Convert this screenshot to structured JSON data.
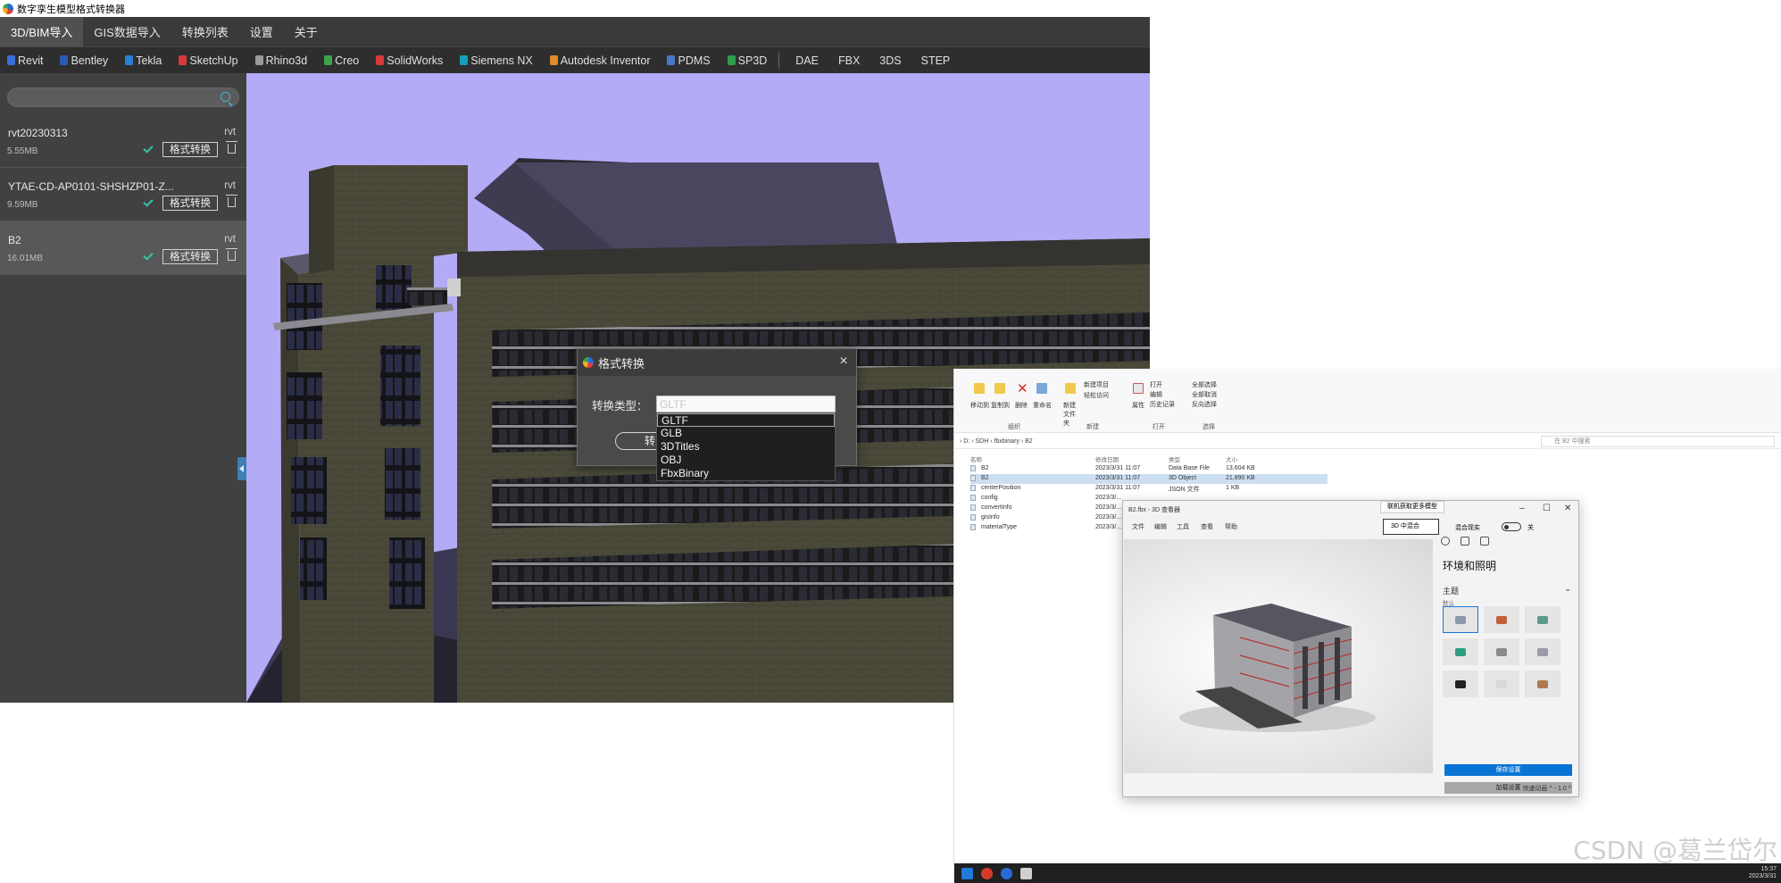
{
  "app": {
    "title": "数字孪生模型格式转换器",
    "menu": [
      "3D/BIM导入",
      "GIS数据导入",
      "转换列表",
      "设置",
      "关于"
    ],
    "formats": [
      {
        "label": "Revit",
        "color": "#3a6fd8"
      },
      {
        "label": "Bentley",
        "color": "#2a5bb8"
      },
      {
        "label": "Tekla",
        "color": "#2a7fd4"
      },
      {
        "label": "SketchUp",
        "color": "#d83a3a"
      },
      {
        "label": "Rhino3d",
        "color": "#9a9a9a"
      },
      {
        "label": "Creo",
        "color": "#3fa34d"
      },
      {
        "label": "SolidWorks",
        "color": "#d83a3a"
      },
      {
        "label": "Siemens NX",
        "color": "#16a0b8"
      },
      {
        "label": "Autodesk Inventor",
        "color": "#e08a2a"
      },
      {
        "label": "PDMS",
        "color": "#4a78c8"
      },
      {
        "label": "SP3D",
        "color": "#2e9e4e"
      }
    ],
    "exts": [
      "DAE",
      "FBX",
      "3DS",
      "STEP"
    ],
    "files": [
      {
        "name": "rvt20230313",
        "ext": "rvt",
        "size": "5.55MB",
        "button": "格式转换"
      },
      {
        "name": "YTAE-CD-AP0101-SHSHZP01-Z...",
        "ext": "rvt",
        "size": "9.59MB",
        "button": "格式转换"
      },
      {
        "name": "B2",
        "ext": "rvt",
        "size": "16.01MB",
        "button": "格式转换"
      }
    ],
    "dialog": {
      "title": "格式转换",
      "label": "转换类型：",
      "selected": "GLTF",
      "ok_fragment": "转",
      "options": [
        "GLTF",
        "GLB",
        "3DTitles",
        "OBJ",
        "FbxBinary"
      ]
    }
  },
  "explorer": {
    "ribbon_groups": [
      "组织",
      "新建",
      "打开",
      "选择"
    ],
    "ribbon_labels": {
      "move": "移动到",
      "copy": "复制到",
      "delete": "删除",
      "rename": "重命名",
      "newfolder": "新建文件夹",
      "newitem": "新建项目",
      "easyaccess": "轻松访问",
      "props": "属性",
      "open": "打开",
      "edit": "编辑",
      "history": "历史记录",
      "selall": "全部选择",
      "selnone": "全部取消",
      "invert": "反向选择"
    },
    "path": "› D:  ›  SDH  ›  fbxbinary  ›  B2",
    "search_placeholder": "在 B2 中搜索",
    "columns": [
      "名称",
      "修改日期",
      "类型",
      "大小"
    ],
    "rows": [
      {
        "name": "B2",
        "date": "2023/3/31 11:07",
        "type": "Data Base File",
        "size": "13,604 KB"
      },
      {
        "name": "B2",
        "date": "2023/3/31 11:07",
        "type": "3D Object",
        "size": "21,890 KB"
      },
      {
        "name": "centerPosition",
        "date": "2023/3/31 11:07",
        "type": "JSON 文件",
        "size": "1 KB"
      },
      {
        "name": "config",
        "date": "2023/3/...",
        "type": "",
        "size": ""
      },
      {
        "name": "convertInfo",
        "date": "2023/3/...",
        "type": "",
        "size": ""
      },
      {
        "name": "gisInfo",
        "date": "2023/3/...",
        "type": "",
        "size": ""
      },
      {
        "name": "materialType",
        "date": "2023/3/...",
        "type": "",
        "size": ""
      }
    ],
    "watermark": "CSDN @葛兰岱尔",
    "clock_time": "15:37",
    "clock_date": "2023/3/31"
  },
  "viewer": {
    "title": "B2.fbx - 3D 查看器",
    "tooltip": "联机获取更多模型",
    "menu": [
      "文件",
      "编辑",
      "工具",
      "查看",
      "帮助"
    ],
    "mixed_reality": "3D 中混合",
    "toggle_label": "混合现实",
    "toggle_state": "关",
    "env_title": "环境和照明",
    "theme": "主题",
    "default_label": "默认",
    "save": "保存设置",
    "load": "加载设置",
    "status": "快速动画  ^     ◦ 1.0  ^",
    "swatch_colors": [
      "#8a9aa8",
      "#c0603a",
      "#5a9a8a",
      "#2e9e7e",
      "#8a8a8a",
      "#9a9aa8",
      "#222222",
      "#d8d8d8",
      "#b07850"
    ]
  }
}
